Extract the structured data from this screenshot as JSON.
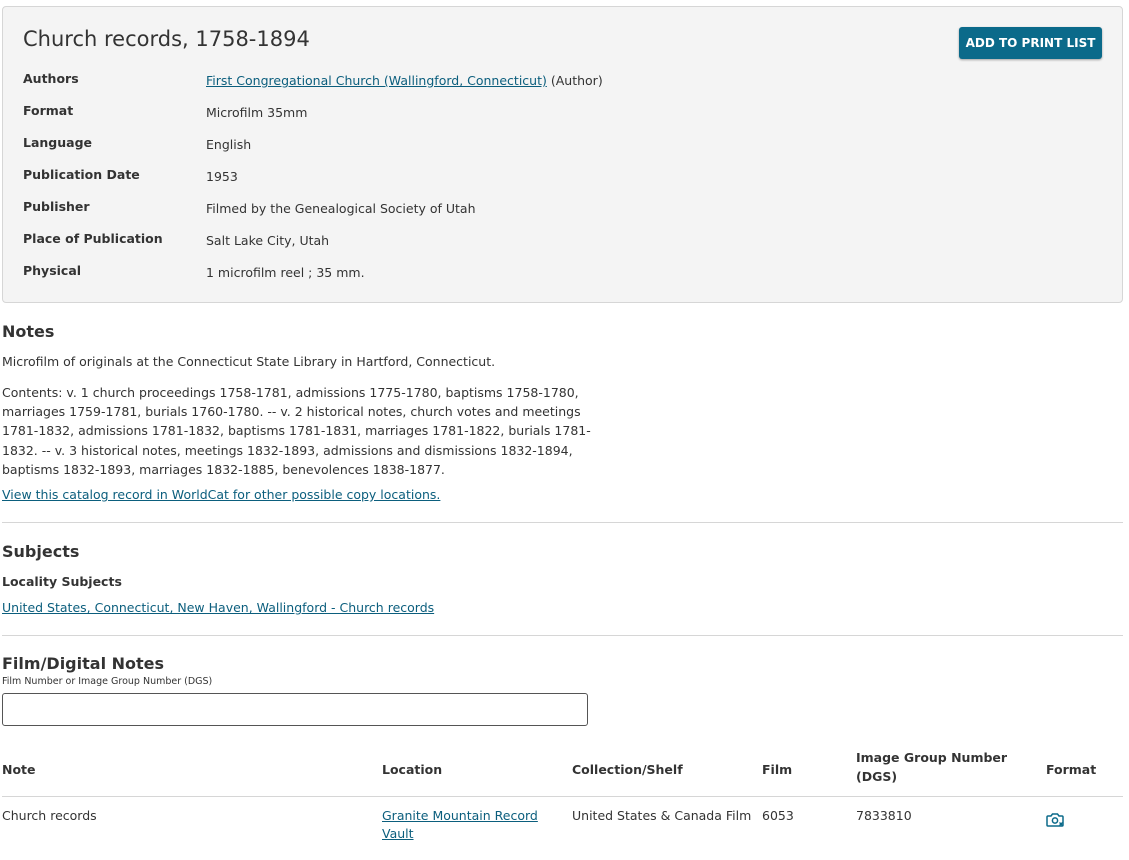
{
  "record": {
    "title": "Church records, 1758-1894",
    "print_button_label": "ADD TO PRINT LIST",
    "authors_label": "Authors",
    "author_link": "First Congregational Church (Wallingford, Connecticut)",
    "author_role": "(Author)",
    "format_label": "Format",
    "format_value": "Microfilm 35mm",
    "language_label": "Language",
    "language_value": "English",
    "pubdate_label": "Publication Date",
    "pubdate_value": "1953",
    "publisher_label": "Publisher",
    "publisher_value": "Filmed by the Genealogical Society of Utah",
    "place_label": "Place of Publication",
    "place_value": "Salt Lake City, Utah",
    "physical_label": "Physical",
    "physical_value": "1 microfilm reel ; 35 mm."
  },
  "notes": {
    "heading": "Notes",
    "note1": "Microfilm of originals at the Connecticut State Library in Hartford, Connecticut.",
    "contents": "Contents: v. 1 church proceedings 1758-1781, admissions 1775-1780, baptisms 1758-1780, marriages 1759-1781, burials 1760-1780. -- v. 2 historical notes, church votes and meetings 1781-1832, admissions 1781-1832, baptisms 1781-1831, marriages 1781-1822, burials 1781- 1832. -- v. 3 historical notes, meetings 1832-1893, admissions and dismissions 1832-1894, baptisms 1832-1893, marriages 1832-1885, benevolences 1838-1877.",
    "worldcat_link": "View this catalog record in WorldCat for other possible copy locations."
  },
  "subjects": {
    "heading": "Subjects",
    "locality_label": "Locality Subjects",
    "locality_link": "United States, Connecticut, New Haven, Wallingford - Church records"
  },
  "film": {
    "heading": "Film/Digital Notes",
    "input_label": "Film Number or Image Group Number (DGS)",
    "input_value": "",
    "input_placeholder": "",
    "columns": {
      "note": "Note",
      "location": "Location",
      "collection": "Collection/Shelf",
      "film": "Film",
      "dgs": "Image Group Number (DGS)",
      "format": "Format"
    },
    "rows": [
      {
        "note": "Church records",
        "location": "Granite Mountain Record Vault",
        "collection": "United States & Canada Film",
        "film": "6053",
        "dgs": "7833810",
        "format_icon": "camera-icon"
      }
    ]
  },
  "colors": {
    "accent": "#0b6a8a",
    "link": "#0b5e7d",
    "card_bg": "#f4f4f4",
    "border": "#d6d6d6"
  }
}
